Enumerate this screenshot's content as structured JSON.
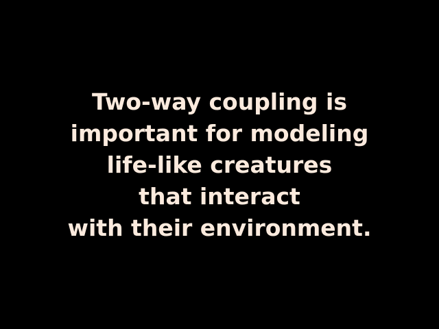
{
  "slide": {
    "lines": [
      "Two-way coupling is",
      "important for modeling",
      "life-like creatures",
      "that interact",
      "with their environment."
    ]
  },
  "colors": {
    "background": "#000000",
    "text": "#fbeadd"
  }
}
